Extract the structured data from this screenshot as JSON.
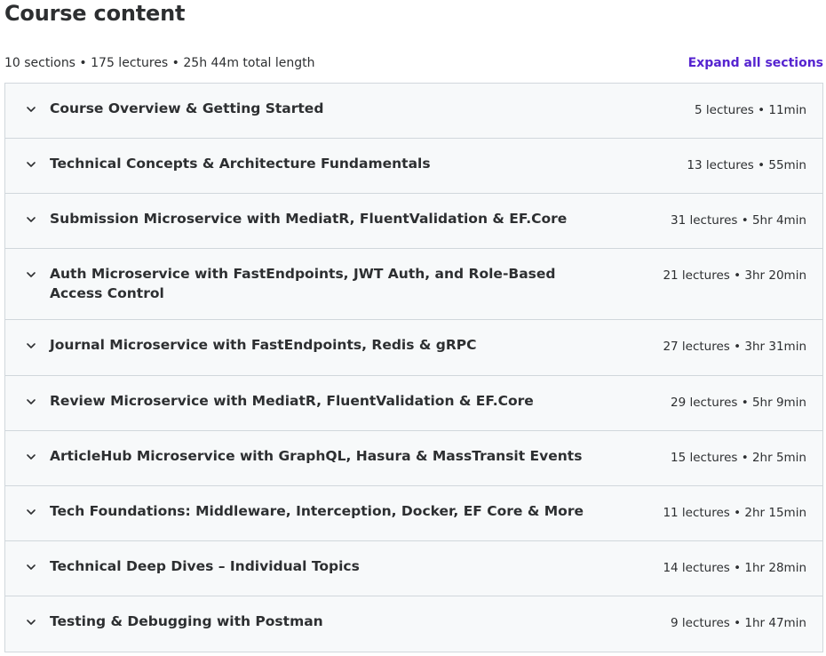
{
  "header": {
    "title": "Course content"
  },
  "summary": {
    "text": "10 sections • 175 lectures • 25h 44m total length",
    "expand_label": "Expand all sections"
  },
  "icons": {
    "section_toggle": "chevron-down-icon"
  },
  "colors": {
    "accent": "#5624d0",
    "section_bg": "#f7f9fa",
    "border": "#d1d7dc",
    "text": "#2d2f31"
  },
  "sections": [
    {
      "title": "Course Overview & Getting Started",
      "meta": "5 lectures • 11min"
    },
    {
      "title": "Technical Concepts & Architecture Fundamentals",
      "meta": "13 lectures • 55min"
    },
    {
      "title": "Submission Microservice with MediatR, FluentValidation & EF.Core",
      "meta": "31 lectures • 5hr 4min"
    },
    {
      "title": "Auth Microservice with FastEndpoints, JWT Auth, and Role-Based Access Control",
      "meta": "21 lectures • 3hr 20min"
    },
    {
      "title": "Journal Microservice with FastEndpoints, Redis & gRPC",
      "meta": "27 lectures • 3hr 31min"
    },
    {
      "title": "Review Microservice with MediatR, FluentValidation & EF.Core",
      "meta": "29 lectures • 5hr 9min"
    },
    {
      "title": "ArticleHub Microservice with GraphQL, Hasura & MassTransit Events",
      "meta": "15 lectures • 2hr 5min"
    },
    {
      "title": "Tech Foundations: Middleware, Interception, Docker, EF Core & More",
      "meta": "11 lectures • 2hr 15min"
    },
    {
      "title": "Technical Deep Dives – Individual Topics",
      "meta": "14 lectures • 1hr 28min"
    },
    {
      "title": "Testing & Debugging with Postman",
      "meta": "9 lectures • 1hr 47min"
    }
  ]
}
